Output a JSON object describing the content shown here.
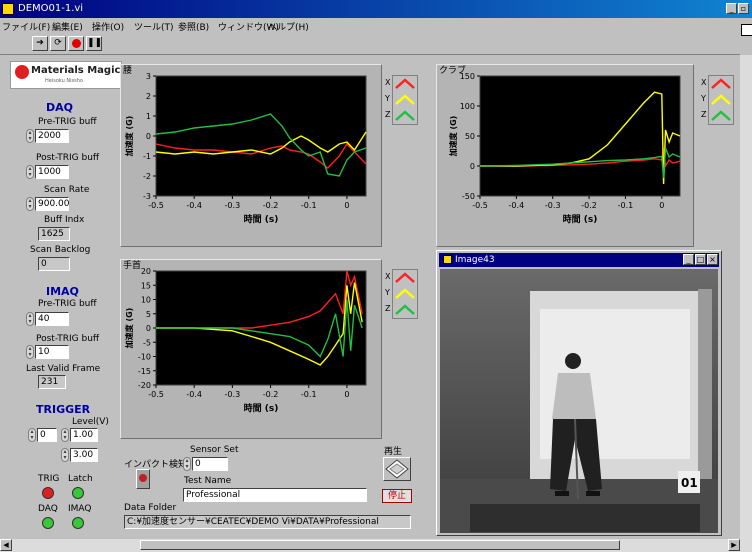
{
  "window": {
    "title": "DEMO01-1.vi"
  },
  "menu": [
    "ファイル(F)",
    "編集(E)",
    "操作(O)",
    "ツール(T)",
    "参照(B)",
    "ウィンドウ(W)",
    "ヘルプ(H)"
  ],
  "brand": {
    "name": "Materials Magic",
    "tagline": "Heisoku Nissho"
  },
  "daq": {
    "title": "DAQ",
    "pre_trig_label": "Pre-TRIG buff",
    "pre_trig": "2000",
    "post_trig_label": "Post-TRIG buff",
    "post_trig": "1000",
    "scan_rate_label": "Scan Rate",
    "scan_rate": "900.00",
    "buff_indx_label": "Buff Indx",
    "buff_indx": "1625",
    "scan_backlog_label": "Scan Backlog",
    "scan_backlog": "0"
  },
  "imaq": {
    "title": "IMAQ",
    "pre_trig_label": "Pre-TRIG buff",
    "pre_trig": "40",
    "post_trig_label": "Post-TRIG buff",
    "post_trig": "10",
    "last_frame_label": "Last Valid Frame",
    "last_frame": "231"
  },
  "trigger": {
    "title": "TRIGGER",
    "level_label": "Level(V)",
    "channel": "0",
    "level1": "1.00",
    "level2": "3.00"
  },
  "leds": {
    "trig": "TRIG",
    "latch": "Latch",
    "daq": "DAQ",
    "imaq": "IMAQ",
    "trig_color": "#e02020",
    "on_color": "#38c838"
  },
  "controls": {
    "impact_label": "インパクト検知",
    "sensor_set_label": "Sensor Set",
    "sensor_set": "0",
    "test_name_label": "Test Name",
    "test_name": "Professional",
    "data_folder_label": "Data Folder",
    "data_folder": "C:¥加速度センサー¥CEATEC¥DEMO Vi¥DATA¥Professional",
    "play_label": "再生",
    "stop_label": "停止"
  },
  "image_window": {
    "title": "Image43",
    "frame_number": "01"
  },
  "colors": {
    "x": "#ff2020",
    "y": "#ffff00",
    "z": "#20c040"
  },
  "chart_data": [
    {
      "type": "line",
      "title": "腰",
      "xlabel": "時間 (s)",
      "ylabel": "加速度 (G)",
      "xlim": [
        -0.5,
        0.05
      ],
      "ylim": [
        -3,
        3
      ],
      "xticks": [
        "-0.5",
        "-0.4",
        "-0.3",
        "-0.2",
        "-0.1",
        "0"
      ],
      "yticks": [
        "3",
        "2",
        "1",
        "0",
        "-1",
        "-2",
        "-3"
      ],
      "x": [
        -0.5,
        -0.45,
        -0.4,
        -0.35,
        -0.3,
        -0.25,
        -0.2,
        -0.17,
        -0.15,
        -0.12,
        -0.1,
        -0.07,
        -0.05,
        -0.02,
        0,
        0.02,
        0.05
      ],
      "series": [
        {
          "name": "X",
          "values": [
            -0.4,
            -0.6,
            -0.7,
            -0.7,
            -0.8,
            -0.9,
            -0.6,
            -0.5,
            -0.7,
            -0.8,
            -0.9,
            -1.3,
            -1.6,
            -1.0,
            -0.4,
            -0.8,
            -1.4
          ]
        },
        {
          "name": "Y",
          "values": [
            -0.8,
            -0.9,
            -0.8,
            -0.9,
            -0.8,
            -0.7,
            -0.9,
            -0.6,
            -0.3,
            0.0,
            -0.2,
            -0.6,
            -0.8,
            -0.4,
            -0.3,
            -0.7,
            0.2
          ]
        },
        {
          "name": "Z",
          "values": [
            0.1,
            0.2,
            0.4,
            0.5,
            0.6,
            0.8,
            1.1,
            0.5,
            -0.1,
            -0.7,
            -1.0,
            -0.8,
            -1.9,
            -2.0,
            -1.2,
            -0.8,
            -0.6
          ]
        }
      ]
    },
    {
      "type": "line",
      "title": "クラブ",
      "xlabel": "時間 (s)",
      "ylabel": "加速度 (G)",
      "xlim": [
        -0.5,
        0.05
      ],
      "ylim": [
        -50,
        150
      ],
      "xticks": [
        "-0.5",
        "-0.4",
        "-0.3",
        "-0.2",
        "-0.1",
        "0"
      ],
      "yticks": [
        "150",
        "100",
        "50",
        "0",
        "-50"
      ],
      "x": [
        -0.5,
        -0.4,
        -0.3,
        -0.25,
        -0.2,
        -0.15,
        -0.1,
        -0.05,
        -0.02,
        0,
        0.005,
        0.01,
        0.02,
        0.03,
        0.05
      ],
      "series": [
        {
          "name": "X",
          "values": [
            0,
            0,
            1,
            2,
            3,
            5,
            8,
            10,
            12,
            10,
            30,
            0,
            10,
            5,
            8
          ]
        },
        {
          "name": "Y",
          "values": [
            0,
            0,
            2,
            5,
            12,
            35,
            70,
            105,
            123,
            120,
            -30,
            60,
            40,
            55,
            50
          ]
        },
        {
          "name": "Z",
          "values": [
            0,
            1,
            3,
            5,
            7,
            9,
            10,
            12,
            14,
            16,
            -20,
            30,
            15,
            20,
            15
          ]
        }
      ]
    },
    {
      "type": "line",
      "title": "手首",
      "xlabel": "時間 (s)",
      "ylabel": "加速度 (G)",
      "xlim": [
        -0.5,
        0.05
      ],
      "ylim": [
        -20,
        20
      ],
      "xticks": [
        "-0.5",
        "-0.4",
        "-0.3",
        "-0.2",
        "-0.1",
        "0"
      ],
      "yticks": [
        "20",
        "15",
        "10",
        "5",
        "0",
        "-5",
        "-10",
        "-15",
        "-20"
      ],
      "x": [
        -0.5,
        -0.4,
        -0.3,
        -0.25,
        -0.2,
        -0.15,
        -0.1,
        -0.07,
        -0.05,
        -0.03,
        -0.01,
        0,
        0.01,
        0.02,
        0.04
      ],
      "series": [
        {
          "name": "X",
          "values": [
            0,
            0,
            0,
            0,
            1,
            2,
            4,
            6,
            9,
            12,
            5,
            20,
            15,
            18,
            5
          ]
        },
        {
          "name": "Y",
          "values": [
            0,
            0,
            -1,
            -3,
            -5,
            -8,
            -11,
            -13,
            -10,
            -6,
            -2,
            15,
            5,
            16,
            2
          ]
        },
        {
          "name": "Z",
          "values": [
            0,
            0,
            0,
            -1,
            -2,
            -3,
            -6,
            -10,
            -4,
            5,
            -10,
            10,
            -8,
            8,
            0
          ]
        }
      ]
    }
  ]
}
